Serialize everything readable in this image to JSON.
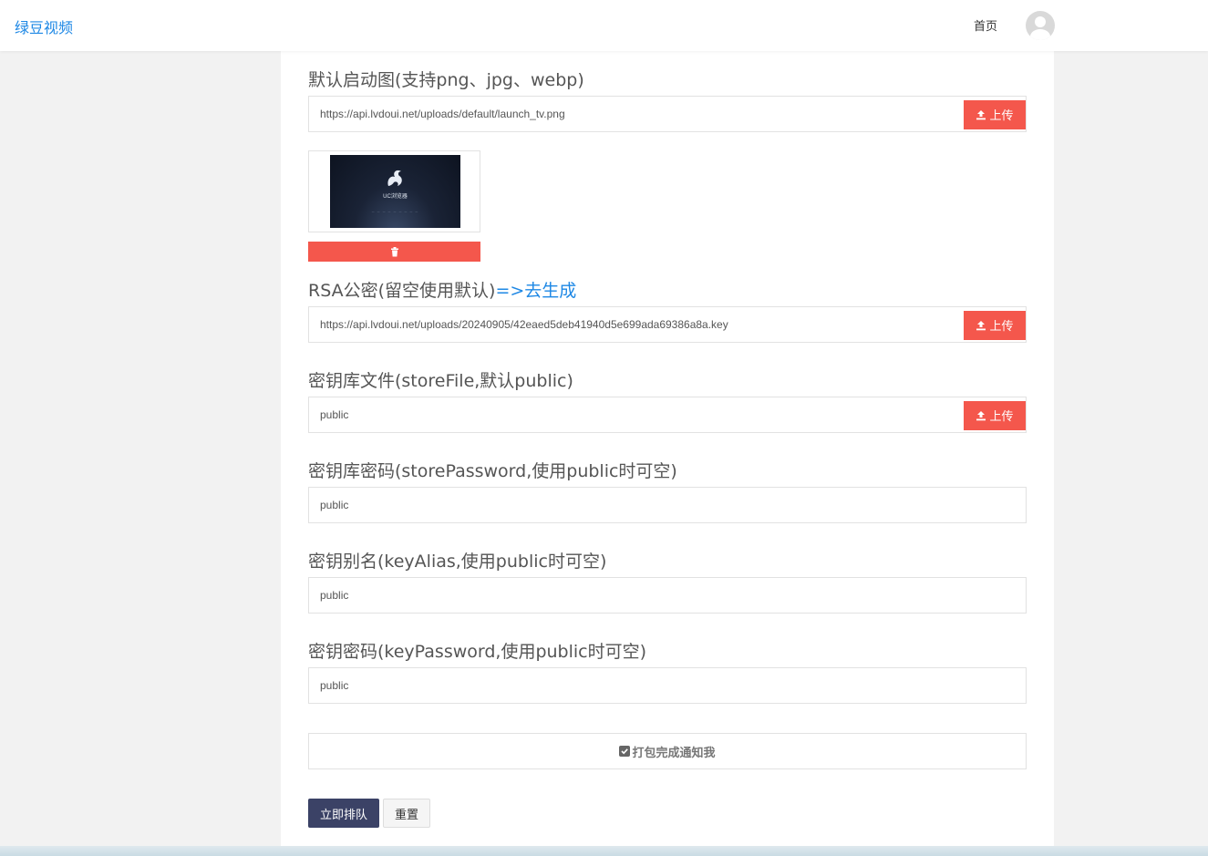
{
  "header": {
    "brand": "绿豆视频",
    "nav_home": "首页"
  },
  "form": {
    "launch_image": {
      "label": "默认启动图(支持png、jpg、webp)",
      "value": "https://api.lvdoui.net/uploads/default/launch_tv.png",
      "upload_label": "上传",
      "preview_brand_text": "UC浏览器"
    },
    "rsa_key": {
      "label": "RSA公密(留空使用默认)",
      "link": "=>去生成",
      "value": "https://api.lvdoui.net/uploads/20240905/42eaed5deb41940d5e699ada69386a8a.key",
      "upload_label": "上传"
    },
    "store_file": {
      "label": "密钥库文件(storeFile,默认public)",
      "value": "public",
      "upload_label": "上传"
    },
    "store_password": {
      "label": "密钥库密码(storePassword,使用public时可空)",
      "value": "public"
    },
    "key_alias": {
      "label": "密钥别名(keyAlias,使用public时可空)",
      "value": "public"
    },
    "key_password": {
      "label": "密钥密码(keyPassword,使用public时可空)",
      "value": "public"
    },
    "notify": {
      "label": "打包完成通知我",
      "checked": true
    },
    "submit_label": "立即排队",
    "reset_label": "重置"
  },
  "colors": {
    "brand": "#1e88e5",
    "danger": "#f4574c",
    "primary_button": "#3b4266"
  },
  "icons": {
    "upload": "upload-icon",
    "delete": "trash-icon",
    "checkbox": "checkbox-checked-icon"
  }
}
